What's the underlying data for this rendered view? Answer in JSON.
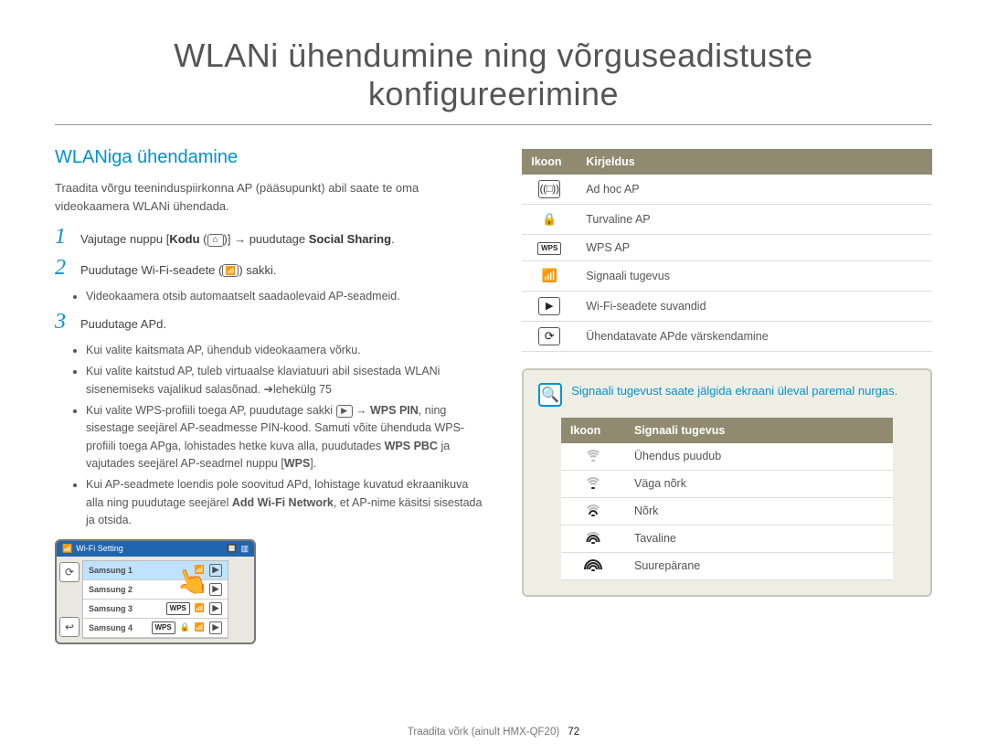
{
  "page": {
    "title": "WLANi ühendumine ning võrguseadistuste konfigureerimine",
    "footer_section": "Traadita võrk (ainult HMX-QF20)",
    "footer_page": "72"
  },
  "left": {
    "heading": "WLANiga ühendamine",
    "intro": "Traadita võrgu teeninduspiirkonna AP (pääsupunkt) abil saate te oma videokaamera WLANi ühendada.",
    "steps": {
      "s1_pre": "Vajutage nuppu [",
      "s1_home": "Kodu",
      "s1_arrow": " → puudutage ",
      "s1_target": "Social Sharing",
      "s1_post": ".",
      "s2_pre": "Puudutage Wi-Fi-seadete (",
      "s2_post": ") sakki.",
      "s2_b1": "Videokaamera otsib automaatselt saadaolevaid AP-seadmeid.",
      "s3": "Puudutage APd.",
      "s3_b1": "Kui valite kaitsmata AP, ühendub videokaamera võrku.",
      "s3_b2": "Kui valite kaitstud AP, tuleb virtuaalse klaviatuuri abil sisestada WLANi sisenemiseks vajalikud salasõnad. ➔lehekülg 75",
      "s3_b3a": "Kui valite WPS-profiili toega AP, puudutage sakki ",
      "s3_b3b": " → ",
      "s3_b3_wps": "WPS PIN",
      "s3_b3c": ", ning sisestage seejärel AP-seadmesse PIN-kood. Samuti võite ühenduda WPS-profiili toega APga, lohistades hetke kuva alla, puudutades ",
      "s3_b3_pbc": "WPS PBC",
      "s3_b3d": " ja vajutades seejärel AP-seadmel nuppu [",
      "s3_b3_wpsbtn": "WPS",
      "s3_b3e": "].",
      "s3_b4a": "Kui AP-seadmete loendis pole soovitud APd, lohistage kuvatud ekraanikuva alla ning puudutage seejärel ",
      "s3_b4_add": "Add Wi-Fi Network",
      "s3_b4b": ", et AP-nime käsitsi sisestada ja otsida."
    },
    "device": {
      "title": "Wi-Fi Setting",
      "rows": [
        "Samsung 1",
        "Samsung 2",
        "Samsung 3",
        "Samsung 4"
      ]
    }
  },
  "right": {
    "table1": {
      "h1": "Ikoon",
      "h2": "Kirjeldus",
      "rows": [
        {
          "icon": "adhoc",
          "label": "Ad hoc AP"
        },
        {
          "icon": "lock",
          "label": "Turvaline AP"
        },
        {
          "icon": "wps",
          "label": "WPS AP"
        },
        {
          "icon": "wifi",
          "label": "Signaali tugevus"
        },
        {
          "icon": "arrow",
          "label": "Wi-Fi-seadete suvandid"
        },
        {
          "icon": "refresh",
          "label": "Ühendatavate APde värskendamine"
        }
      ]
    },
    "note": "Signaali tugevust saate jälgida ekraani üleval paremal nurgas.",
    "table2": {
      "h1": "Ikoon",
      "h2": "Signaali tugevus",
      "rows": [
        {
          "level": 0,
          "label": "Ühendus puudub"
        },
        {
          "level": 1,
          "label": "Väga nõrk"
        },
        {
          "level": 2,
          "label": "Nõrk"
        },
        {
          "level": 3,
          "label": "Tavaline"
        },
        {
          "level": 4,
          "label": "Suurepärane"
        }
      ]
    }
  }
}
